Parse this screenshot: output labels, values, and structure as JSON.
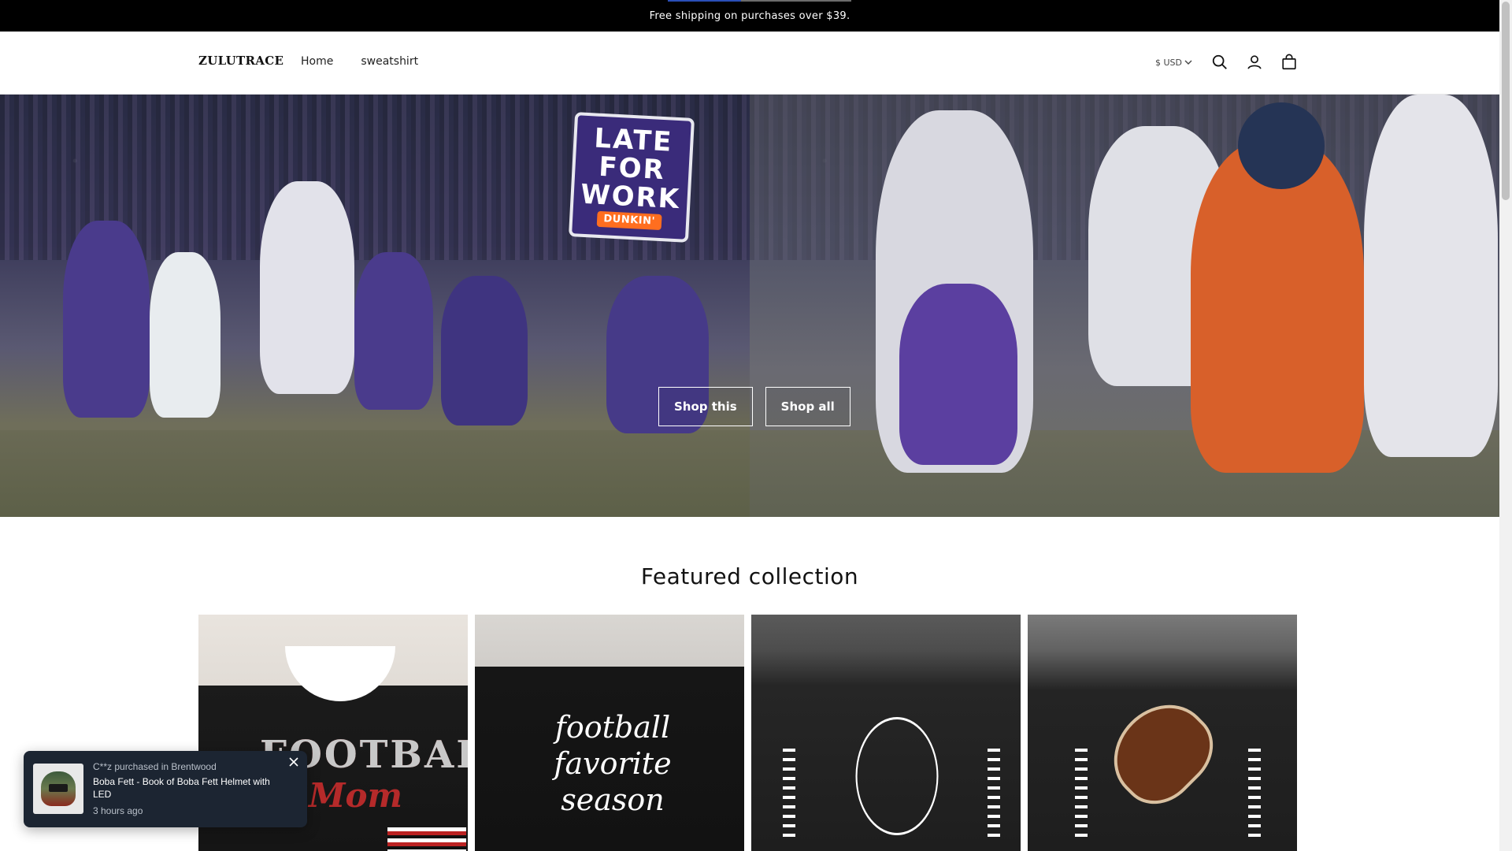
{
  "announcement": {
    "text": "Free shipping on purchases over $39."
  },
  "header": {
    "logo": "ZULUTRACE",
    "nav": [
      {
        "label": "Home"
      },
      {
        "label": "sweatshirt"
      }
    ],
    "currency": "$ USD",
    "icons": [
      "search-icon",
      "account-icon",
      "cart-icon"
    ]
  },
  "hero": {
    "badge": {
      "line1": "LATE",
      "line2": "FOR",
      "line3": "WORK",
      "sub": "DUNKIN'"
    },
    "buttons": [
      {
        "label": "Shop this"
      },
      {
        "label": "Shop all"
      }
    ]
  },
  "featured": {
    "title": "Featured collection",
    "products": [
      {
        "print_main": "FOOTBALL",
        "print_sub": "Mom"
      },
      {
        "print_main": "football favorite season"
      },
      {},
      {}
    ]
  },
  "popup": {
    "who": "C**z purchased in Brentwood",
    "product": "Boba Fett - Book of Boba Fett Helmet with LED",
    "time": "3 hours ago"
  },
  "colors": {
    "announcement_bg": "#000000",
    "popup_bg": "#1c2532",
    "accent_orange": "#ff6e1f",
    "badge_purple": "#3a2b7a"
  }
}
